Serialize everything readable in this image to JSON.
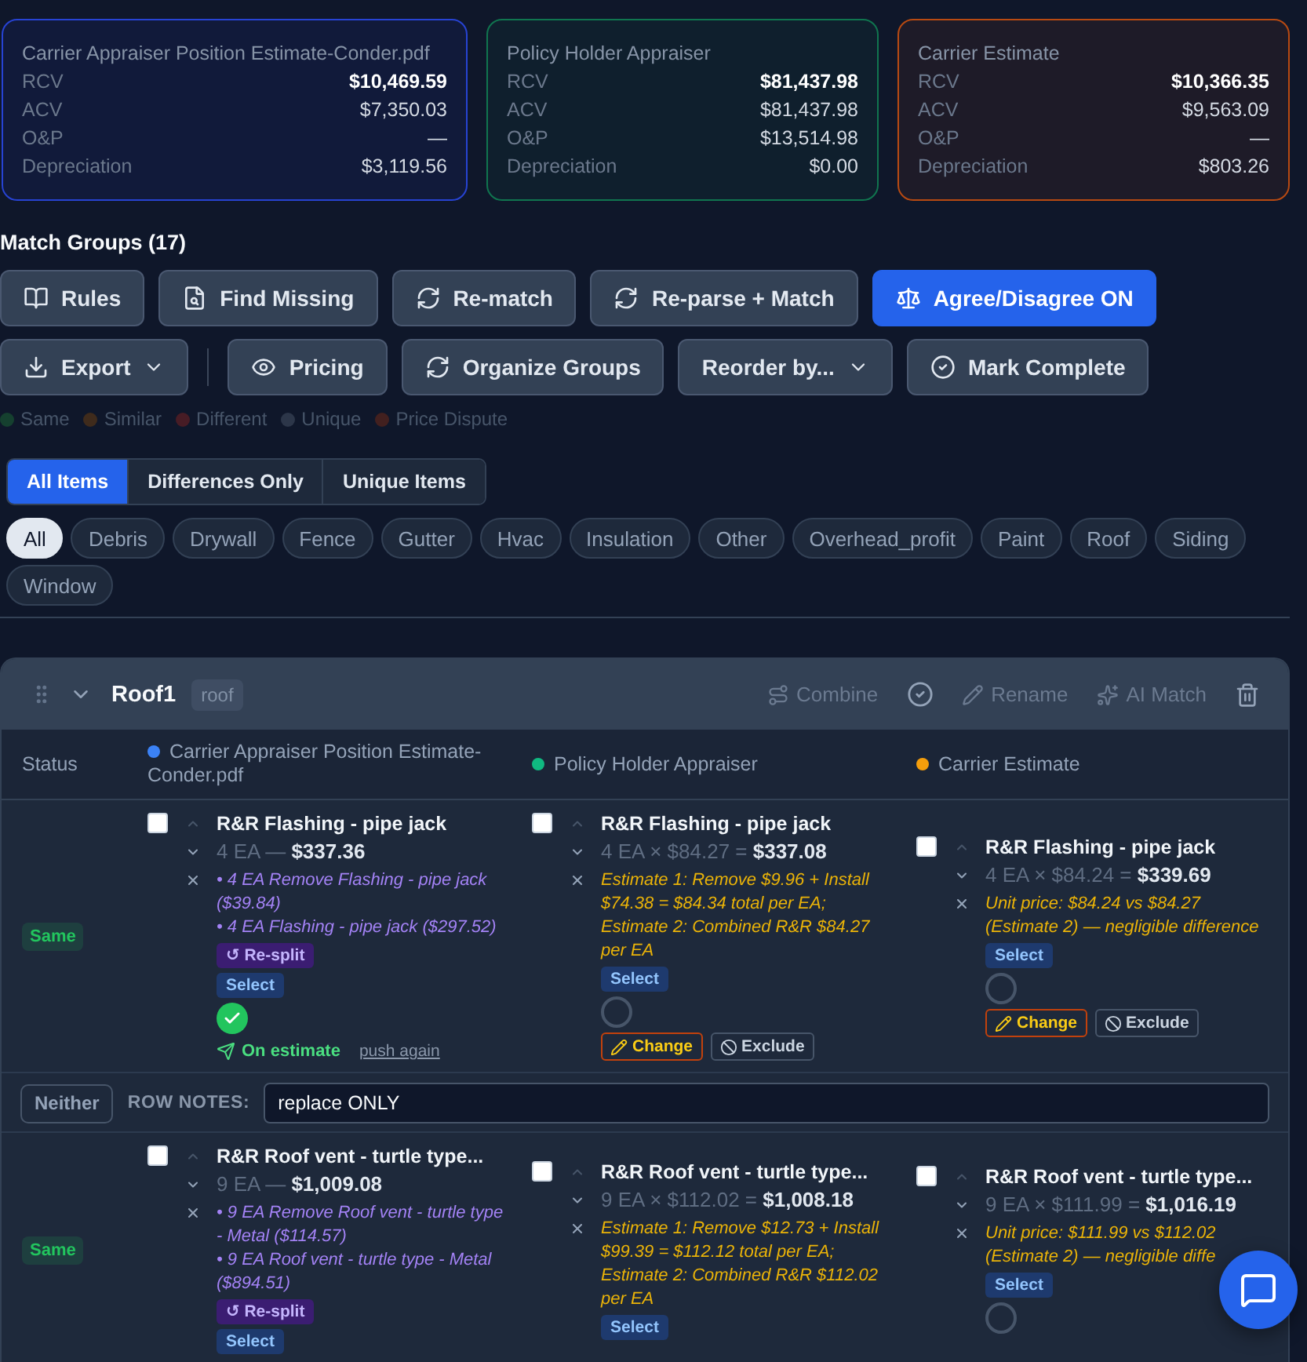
{
  "summary_cards": [
    {
      "title": "Carrier Appraiser Position Estimate-Conder.pdf",
      "color": "#2743d3",
      "rows": [
        {
          "label": "RCV",
          "value": "$10,469.59",
          "kind": "total"
        },
        {
          "label": "ACV",
          "value": "$7,350.03",
          "kind": "amount"
        },
        {
          "label": "O&P",
          "value": "—",
          "kind": "amount"
        },
        {
          "label": "Depreciation",
          "value": "$3,119.56",
          "kind": "amount"
        }
      ]
    },
    {
      "title": "Policy Holder Appraiser",
      "color": "#10754f",
      "rows": [
        {
          "label": "RCV",
          "value": "$81,437.98",
          "kind": "total"
        },
        {
          "label": "ACV",
          "value": "$81,437.98",
          "kind": "amount"
        },
        {
          "label": "O&P",
          "value": "$13,514.98",
          "kind": "amount"
        },
        {
          "label": "Depreciation",
          "value": "$0.00",
          "kind": "amount"
        }
      ]
    },
    {
      "title": "Carrier Estimate",
      "color": "#b84a12",
      "rows": [
        {
          "label": "RCV",
          "value": "$10,366.35",
          "kind": "total"
        },
        {
          "label": "ACV",
          "value": "$9,563.09",
          "kind": "amount"
        },
        {
          "label": "O&P",
          "value": "—",
          "kind": "amount"
        },
        {
          "label": "Depreciation",
          "value": "$803.26",
          "kind": "amount"
        }
      ]
    }
  ],
  "section_title": "Match Groups (17)",
  "toolbar_rows": [
    {
      "items": [
        {
          "kind": "button",
          "label": "Rules",
          "active": false,
          "dropdown": false
        },
        {
          "kind": "button",
          "label": "Find Missing",
          "active": false,
          "dropdown": false
        },
        {
          "kind": "button",
          "label": "Re-match",
          "active": false,
          "dropdown": false
        },
        {
          "kind": "button",
          "label": "Re-parse + Match",
          "active": false,
          "dropdown": false
        },
        {
          "kind": "button",
          "label": "Agree/Disagree ON",
          "active": true,
          "dropdown": false
        }
      ]
    },
    {
      "items": [
        {
          "kind": "button",
          "label": "Export",
          "active": false,
          "dropdown": true
        },
        {
          "kind": "divider"
        },
        {
          "kind": "button",
          "label": "Pricing",
          "active": false,
          "dropdown": false
        },
        {
          "kind": "button",
          "label": "Organize Groups",
          "active": false,
          "dropdown": false
        },
        {
          "kind": "button",
          "label": "Reorder by...",
          "active": false,
          "dropdown": true
        },
        {
          "kind": "button",
          "label": "Mark Complete",
          "active": false,
          "dropdown": false
        }
      ]
    }
  ],
  "legend": [
    {
      "label": "Same",
      "color": "#15402f"
    },
    {
      "label": "Similar",
      "color": "#3f2b1c"
    },
    {
      "label": "Different",
      "color": "#471c25"
    },
    {
      "label": "Unique",
      "color": "#2c3649"
    },
    {
      "label": "Price Dispute",
      "color": "#42201f"
    }
  ],
  "view_tabs": [
    {
      "label": "All Items",
      "selected": true
    },
    {
      "label": "Differences Only",
      "selected": false
    },
    {
      "label": "Unique Items",
      "selected": false
    }
  ],
  "category_chips": [
    {
      "label": "All",
      "selected": true
    },
    {
      "label": "Debris",
      "selected": false
    },
    {
      "label": "Drywall",
      "selected": false
    },
    {
      "label": "Fence",
      "selected": false
    },
    {
      "label": "Gutter",
      "selected": false
    },
    {
      "label": "Hvac",
      "selected": false
    },
    {
      "label": "Insulation",
      "selected": false
    },
    {
      "label": "Other",
      "selected": false
    },
    {
      "label": "Overhead_profit",
      "selected": false
    },
    {
      "label": "Paint",
      "selected": false
    },
    {
      "label": "Roof",
      "selected": false
    },
    {
      "label": "Siding",
      "selected": false
    },
    {
      "label": "Window",
      "selected": false
    }
  ],
  "group": {
    "name": "Roof1",
    "tag": "roof",
    "expanded": true,
    "actions": [
      "Combine",
      "Rename",
      "AI Match"
    ],
    "status_header": "Status",
    "columns": [
      {
        "label": "Carrier Appraiser Position Estimate-Conder.pdf",
        "color": "#3b82f6"
      },
      {
        "label": "Policy Holder Appraiser",
        "color": "#10b981"
      },
      {
        "label": "Carrier Estimate",
        "color": "#f59e0b"
      }
    ],
    "rows": [
      {
        "status": {
          "label": "Same",
          "color": "#22c55e"
        },
        "cells": [
          {
            "checked": false,
            "title": "R&R Flashing - pipe jack",
            "amount": "4 EA — **$337.36**",
            "splits": [
              "• 4 EA Remove Flashing - pipe jack ($39.84)",
              "• 4 EA Flashing - pipe jack ($297.52)"
            ],
            "resplit": "↺ Re-split",
            "select": "Select",
            "on_estimate": true,
            "push_status": "On estimate",
            "push_link": "push again"
          },
          {
            "checked": false,
            "title": "R&R Flashing - pipe jack",
            "amount": "4 EA × $84.27 = **$337.08**",
            "note": "Estimate 1: Remove $9.96 + Install $74.38 = $84.34 total per EA; Estimate 2: Combined R&R $84.27 per EA",
            "select": "Select",
            "on_estimate": false,
            "actions": [
              {
                "kind": "change",
                "label": "Change"
              },
              {
                "kind": "exclude",
                "label": "Exclude"
              }
            ]
          },
          {
            "checked": false,
            "title": "R&R Flashing - pipe jack",
            "amount": "4 EA × $84.24 = **$339.69**",
            "note": "Unit price: $84.24 vs $84.27 (Estimate 2) — negligible difference",
            "select": "Select",
            "on_estimate": false,
            "actions": [
              {
                "kind": "change",
                "label": "Change"
              },
              {
                "kind": "exclude",
                "label": "Exclude"
              }
            ]
          }
        ],
        "notes": {
          "button": "Neither",
          "label": "ROW NOTES:",
          "value": "replace ONLY"
        }
      },
      {
        "status": {
          "label": "Same",
          "color": "#22c55e"
        },
        "cells": [
          {
            "checked": false,
            "title": "R&R Roof vent - turtle type...",
            "amount": "9 EA — **$1,009.08**",
            "splits": [
              "• 9 EA Remove Roof vent - turtle type - Metal ($114.57)",
              "• 9 EA Roof vent - turtle type - Metal ($894.51)"
            ],
            "resplit": "↺ Re-split",
            "select": "Select"
          },
          {
            "checked": false,
            "title": "R&R Roof vent - turtle type...",
            "amount": "9 EA × $112.02 = **$1,008.18**",
            "note": "Estimate 1: Remove $12.73 + Install $99.39 = $112.12 total per EA; Estimate 2: Combined R&R $112.02 per EA",
            "select": "Select"
          },
          {
            "checked": false,
            "title": "R&R Roof vent - turtle type...",
            "amount": "9 EA × $111.99 = **$1,016.19**",
            "note": "Unit price: $111.99 vs $112.02 (Estimate 2) — negligible diffe",
            "select": "Select",
            "on_estimate": false
          }
        ]
      }
    ]
  }
}
